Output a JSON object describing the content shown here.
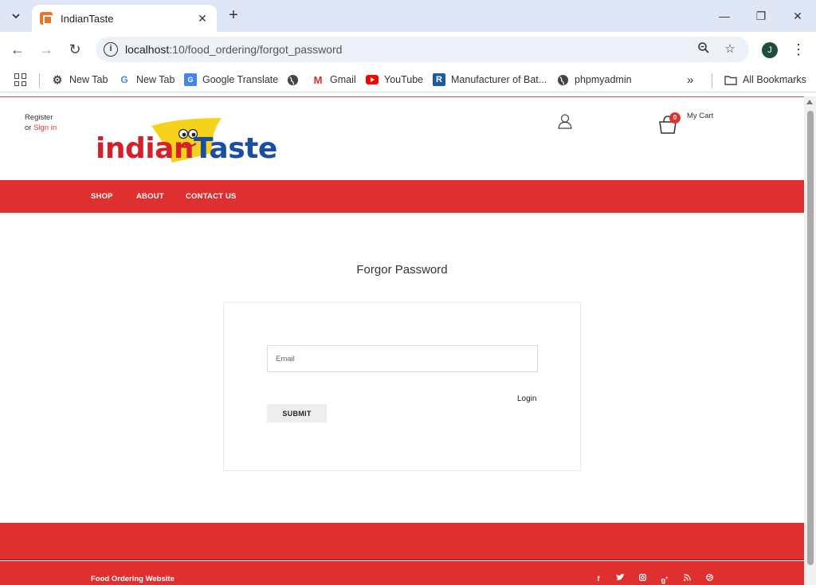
{
  "browser": {
    "tab_title": "IndianTaste",
    "url_host": "localhost",
    "url_rest": ":10/food_ordering/forgot_password",
    "profile_initial": "J",
    "bookmarks": [
      {
        "label": "New Tab",
        "icon": "gear-icon"
      },
      {
        "label": "New Tab",
        "icon": "google-icon"
      },
      {
        "label": "Google Translate",
        "icon": "translate-icon"
      },
      {
        "label": "",
        "icon": "globe-icon"
      },
      {
        "label": "Gmail",
        "icon": "gmail-icon"
      },
      {
        "label": "YouTube",
        "icon": "youtube-icon"
      },
      {
        "label": "Manufacturer of Bat...",
        "icon": "r-icon"
      },
      {
        "label": "phpmyadmin",
        "icon": "globe-icon"
      }
    ],
    "all_bookmarks": "All Bookmarks",
    "icons": {
      "back": "arrow-left-icon",
      "forward": "arrow-right-icon",
      "reload": "reload-icon",
      "zoom": "zoom-icon",
      "star": "star-icon"
    }
  },
  "site": {
    "logo": {
      "part1": "indian",
      "part2": "Taste"
    },
    "header": {
      "register": "Register",
      "or": "or",
      "sign_in": "Sign in",
      "cart_count": "0",
      "cart_label": "My Cart"
    },
    "nav": [
      "SHOP",
      "ABOUT",
      "CONTACT US"
    ],
    "colors": {
      "brand_red": "#e02f2f",
      "logo_blue": "#1b4ea0",
      "logo_yellow": "#f7d21d"
    }
  },
  "forgot": {
    "title": "Forgor Password",
    "email_placeholder": "Email",
    "login_link": "Login",
    "submit_label": "SUBMIT"
  },
  "footer": {
    "text": "Food Ordering Website",
    "social_icons": [
      "facebook-icon",
      "twitter-icon",
      "instagram-icon",
      "google-plus-icon",
      "rss-icon",
      "dribbble-icon"
    ]
  }
}
